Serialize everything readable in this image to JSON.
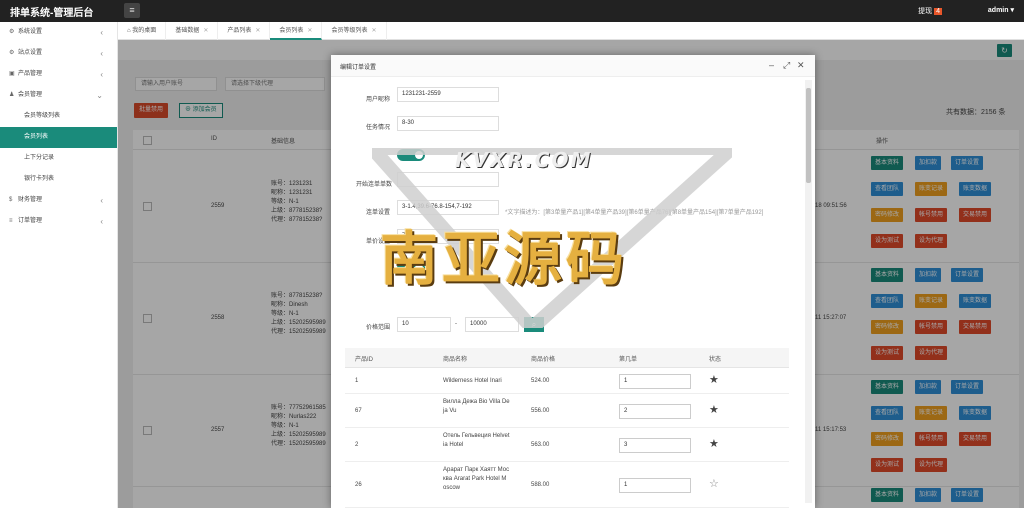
{
  "app": {
    "title": "排单系统-管理后台",
    "tip_label": "提现",
    "tip_count": "4",
    "user": "admin"
  },
  "sidebar": {
    "items": [
      {
        "label": "系统设置",
        "icon": "gear-icon",
        "glyph": "⚙",
        "arrow": "‹"
      },
      {
        "label": "站点设置",
        "icon": "gear-icon",
        "glyph": "⚙",
        "arrow": "‹"
      },
      {
        "label": "产品管理",
        "icon": "box-icon",
        "glyph": "▣",
        "arrow": "‹"
      },
      {
        "label": "会员管理",
        "icon": "user-icon",
        "glyph": "♟",
        "arrow": "⌄"
      },
      {
        "label": "会员等级列表",
        "sub": true
      },
      {
        "label": "会员列表",
        "sub": true,
        "active": true
      },
      {
        "label": "上下分记录",
        "sub": true
      },
      {
        "label": "银行卡列表",
        "sub": true
      },
      {
        "label": "财务管理",
        "icon": "money-icon",
        "glyph": "$",
        "arrow": "‹"
      },
      {
        "label": "订单管理",
        "icon": "list-icon",
        "glyph": "≡",
        "arrow": "‹"
      }
    ]
  },
  "tabs": [
    {
      "label": "我的桌面",
      "home": true
    },
    {
      "label": "基础数据"
    },
    {
      "label": "产品列表"
    },
    {
      "label": "会员列表",
      "active": true
    },
    {
      "label": "会员等级列表"
    }
  ],
  "filters": {
    "account_placeholder": "请输入用户账号",
    "level_placeholder": "请选择下级代理"
  },
  "actions": {
    "ban": "批量禁用",
    "add": "添加会员"
  },
  "total": "共有数据：2156 条",
  "table": {
    "headers": [
      "ID",
      "基础信息",
      "操作"
    ],
    "rows": [
      {
        "id": "2559",
        "info": "账号：1231231\n昵称：1231231\n等级：N-1\n上级：877815238?\n代理：877815238?",
        "time": "18 09:51:56"
      },
      {
        "id": "2558",
        "info": "账号：877815238?\n昵称：Dinesh\n等级：N-1\n上级：15202595989\n代理：15202595989",
        "time": "11 15:27:07"
      },
      {
        "id": "2557",
        "info": "账号：77752961585\n昵称：Nurlas222\n等级：N-1\n上级：15202595989\n代理：15202595989",
        "time": "11 15:17:53"
      }
    ],
    "btns": {
      "basic": "基本资料",
      "add": "加扣款",
      "order": "订单设置",
      "team": "查看团队",
      "account": "账变记录",
      "set_data": "账变数据",
      "pwd": "密码修改",
      "ban": "帐号禁用",
      "trade_ban": "交易禁用",
      "test": "设为测试",
      "agent": "设为代理"
    }
  },
  "modal": {
    "title": "编辑订单设置",
    "nickname_label": "用户昵称",
    "nickname": "1231231-2559",
    "task_label": "任务情况",
    "task": "8-30",
    "start_label": "开始连单单数",
    "chain_label": "连单设置",
    "chain_value": "3-1.4,39.6-76.8-154,7-192",
    "chain_hint": "*文字描述为：[第3单量产品1][第4单量产品39][第6单量产品76][第8单量产品154][第7单量产品192]",
    "prob_label": "单价设置",
    "prob_value": "7.2",
    "range_label": "价格范围",
    "range_min": "10",
    "range_sep": "-",
    "range_max": "10000",
    "products": {
      "headers": [
        "产品ID",
        "商品名称",
        "商品价格",
        "第几单",
        "状态"
      ],
      "rows": [
        {
          "id": "1",
          "name": "Wilderness Hotel Inari",
          "price": "524.00",
          "nth": "1",
          "starred": true
        },
        {
          "id": "67",
          "name": "Вилла Дежа Bio Villa De\nja Vu",
          "price": "556.00",
          "nth": "2",
          "starred": true
        },
        {
          "id": "2",
          "name": "Отель Гельвеция Helvet\nia Hotel",
          "price": "563.00",
          "nth": "3",
          "starred": true
        },
        {
          "id": "26",
          "name": "Арарат Парк Хаятт Мос\nква Ararat Park Hotel M\noscow",
          "price": "588.00",
          "nth": "1",
          "starred": false
        }
      ]
    }
  },
  "watermark": {
    "small": "KVXR.COM",
    "big": "南亚源码",
    "colors": {
      "gold": "#e5b040",
      "teal": "#1a8b7b"
    }
  }
}
